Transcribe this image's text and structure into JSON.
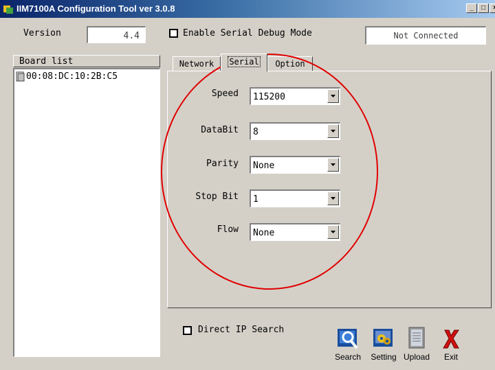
{
  "window": {
    "title": "IIM7100A Configuration Tool ver 3.0.8"
  },
  "top": {
    "version_label": "Version",
    "version_value": "4.4",
    "debug_label": "Enable Serial Debug Mode",
    "status": "Not Connected"
  },
  "board_list": {
    "header": "Board list",
    "items": [
      "00:08:DC:10:2B:C5"
    ]
  },
  "tabs": [
    "Network",
    "Serial",
    "Option"
  ],
  "serial": {
    "speed_label": "Speed",
    "speed_value": "115200",
    "databit_label": "DataBit",
    "databit_value": "8",
    "parity_label": "Parity",
    "parity_value": "None",
    "stopbit_label": "Stop Bit",
    "stopbit_value": "1",
    "flow_label": "Flow",
    "flow_value": "None"
  },
  "bottom": {
    "direct_ip_label": "Direct IP Search",
    "search_label": "Search",
    "setting_label": "Setting",
    "upload_label": "Upload",
    "exit_label": "Exit"
  }
}
